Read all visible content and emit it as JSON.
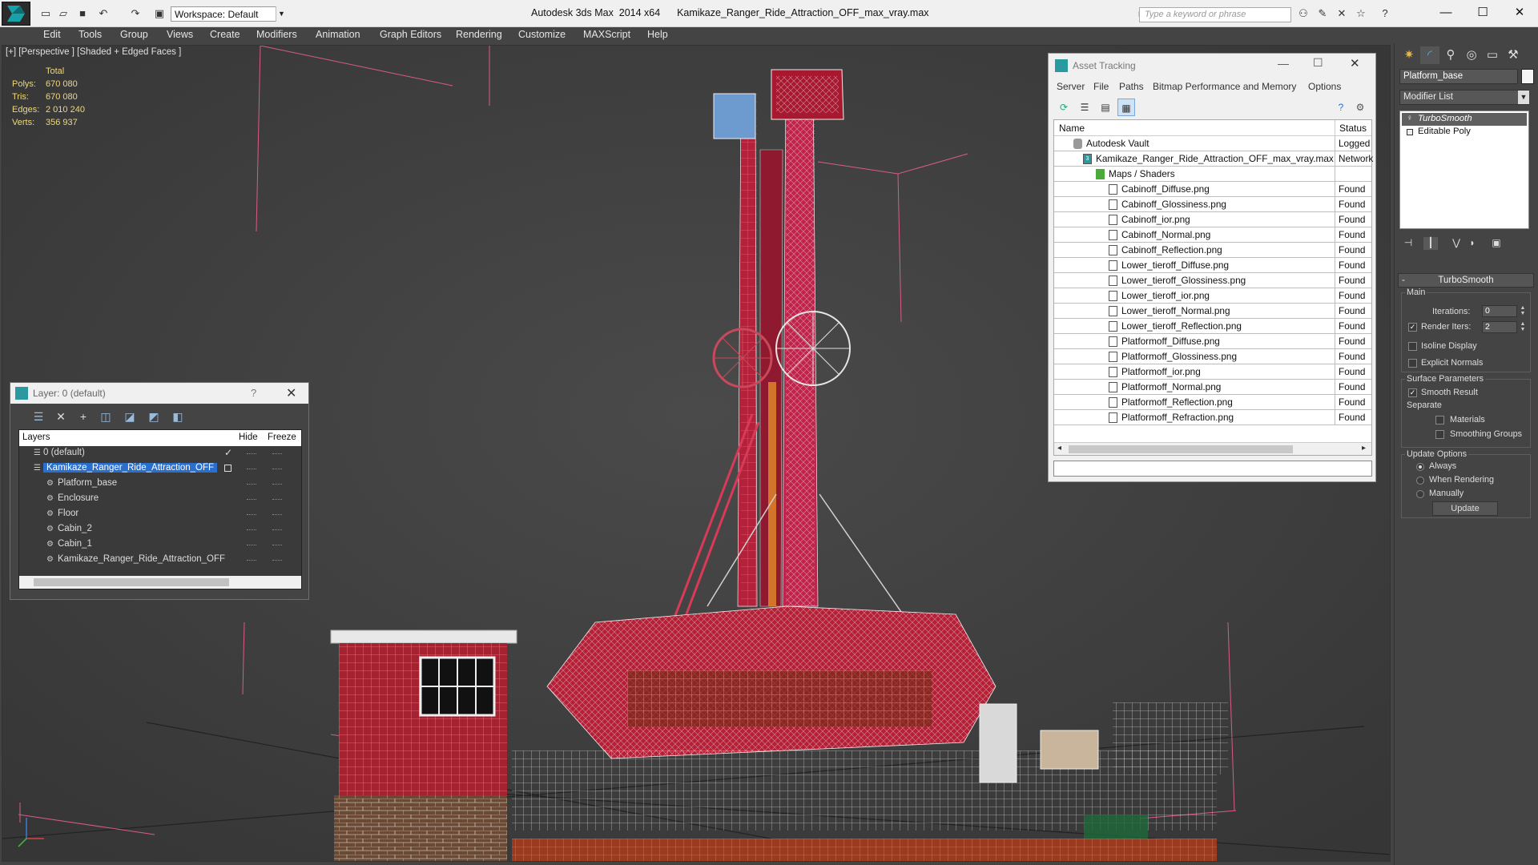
{
  "titlebar": {
    "app_title": "Autodesk 3ds Max  2014 x64",
    "file_title": "Kamikaze_Ranger_Ride_Attraction_OFF_max_vray.max",
    "workspace": "Workspace: Default",
    "search_placeholder": "Type a keyword or phrase"
  },
  "menu": [
    "Edit",
    "Tools",
    "Group",
    "Views",
    "Create",
    "Modifiers",
    "Animation",
    "Graph Editors",
    "Rendering",
    "Customize",
    "MAXScript",
    "Help"
  ],
  "viewport": {
    "label": "[+] [Perspective ] [Shaded + Edged Faces ]",
    "stats": {
      "total_label": "Total",
      "polys_label": "Polys:",
      "polys": "670 080",
      "tris_label": "Tris:",
      "tris": "670 080",
      "edges_label": "Edges:",
      "edges": "2 010 240",
      "verts_label": "Verts:",
      "verts": "356 937"
    }
  },
  "layer_dialog": {
    "title": "Layer: 0 (default)",
    "help": "?",
    "col_layers": "Layers",
    "col_hide": "Hide",
    "col_freeze": "Freeze",
    "rows": [
      {
        "name": "0 (default)",
        "indent": 0
      },
      {
        "name": "Kamikaze_Ranger_Ride_Attraction_OFF",
        "indent": 0,
        "selected": true
      },
      {
        "name": "Platform_base",
        "indent": 1
      },
      {
        "name": "Enclosure",
        "indent": 1
      },
      {
        "name": "Floor",
        "indent": 1
      },
      {
        "name": "Cabin_2",
        "indent": 1
      },
      {
        "name": "Cabin_1",
        "indent": 1
      },
      {
        "name": "Kamikaze_Ranger_Ride_Attraction_OFF",
        "indent": 1
      }
    ]
  },
  "asset_tracking": {
    "title": "Asset Tracking",
    "menu": [
      "Server",
      "File",
      "Paths",
      "Bitmap Performance and Memory",
      "Options"
    ],
    "col_name": "Name",
    "col_status": "Status",
    "rows": [
      {
        "name": "Autodesk Vault",
        "status": "Logged",
        "level": 0
      },
      {
        "name": "Kamikaze_Ranger_Ride_Attraction_OFF_max_vray.max",
        "status": "Network",
        "level": 1
      },
      {
        "name": "Maps / Shaders",
        "status": "",
        "level": 2
      },
      {
        "name": "Cabinoff_Diffuse.png",
        "status": "Found",
        "level": 3
      },
      {
        "name": "Cabinoff_Glossiness.png",
        "status": "Found",
        "level": 3
      },
      {
        "name": "Cabinoff_ior.png",
        "status": "Found",
        "level": 3
      },
      {
        "name": "Cabinoff_Normal.png",
        "status": "Found",
        "level": 3
      },
      {
        "name": "Cabinoff_Reflection.png",
        "status": "Found",
        "level": 3
      },
      {
        "name": "Lower_tieroff_Diffuse.png",
        "status": "Found",
        "level": 3
      },
      {
        "name": "Lower_tieroff_Glossiness.png",
        "status": "Found",
        "level": 3
      },
      {
        "name": "Lower_tieroff_ior.png",
        "status": "Found",
        "level": 3
      },
      {
        "name": "Lower_tieroff_Normal.png",
        "status": "Found",
        "level": 3
      },
      {
        "name": "Lower_tieroff_Reflection.png",
        "status": "Found",
        "level": 3
      },
      {
        "name": "Platformoff_Diffuse.png",
        "status": "Found",
        "level": 3
      },
      {
        "name": "Platformoff_Glossiness.png",
        "status": "Found",
        "level": 3
      },
      {
        "name": "Platformoff_ior.png",
        "status": "Found",
        "level": 3
      },
      {
        "name": "Platformoff_Normal.png",
        "status": "Found",
        "level": 3
      },
      {
        "name": "Platformoff_Reflection.png",
        "status": "Found",
        "level": 3
      },
      {
        "name": "Platformoff_Refraction.png",
        "status": "Found",
        "level": 3
      }
    ]
  },
  "command_panel": {
    "object_name": "Platform_base",
    "modifier_list": "Modifier List",
    "stack": [
      "TurboSmooth",
      "Editable Poly"
    ],
    "turbosmooth": {
      "header": "TurboSmooth",
      "collapse": "-",
      "main_label": "Main",
      "iterations_label": "Iterations:",
      "iterations": "0",
      "render_iters_label": "Render Iters:",
      "render_iters": "2",
      "isoline": "Isoline Display",
      "explicit": "Explicit Normals",
      "surface_label": "Surface Parameters",
      "smooth_result": "Smooth Result",
      "separate_label": "Separate",
      "materials": "Materials",
      "smoothing_groups": "Smoothing Groups",
      "update_label": "Update Options",
      "always": "Always",
      "when_rendering": "When Rendering",
      "manually": "Manually",
      "update_btn": "Update"
    }
  },
  "colors": {
    "selection": "#2b6fcc",
    "stats_text": "#f0d878",
    "ride_red": "#b3223a"
  }
}
